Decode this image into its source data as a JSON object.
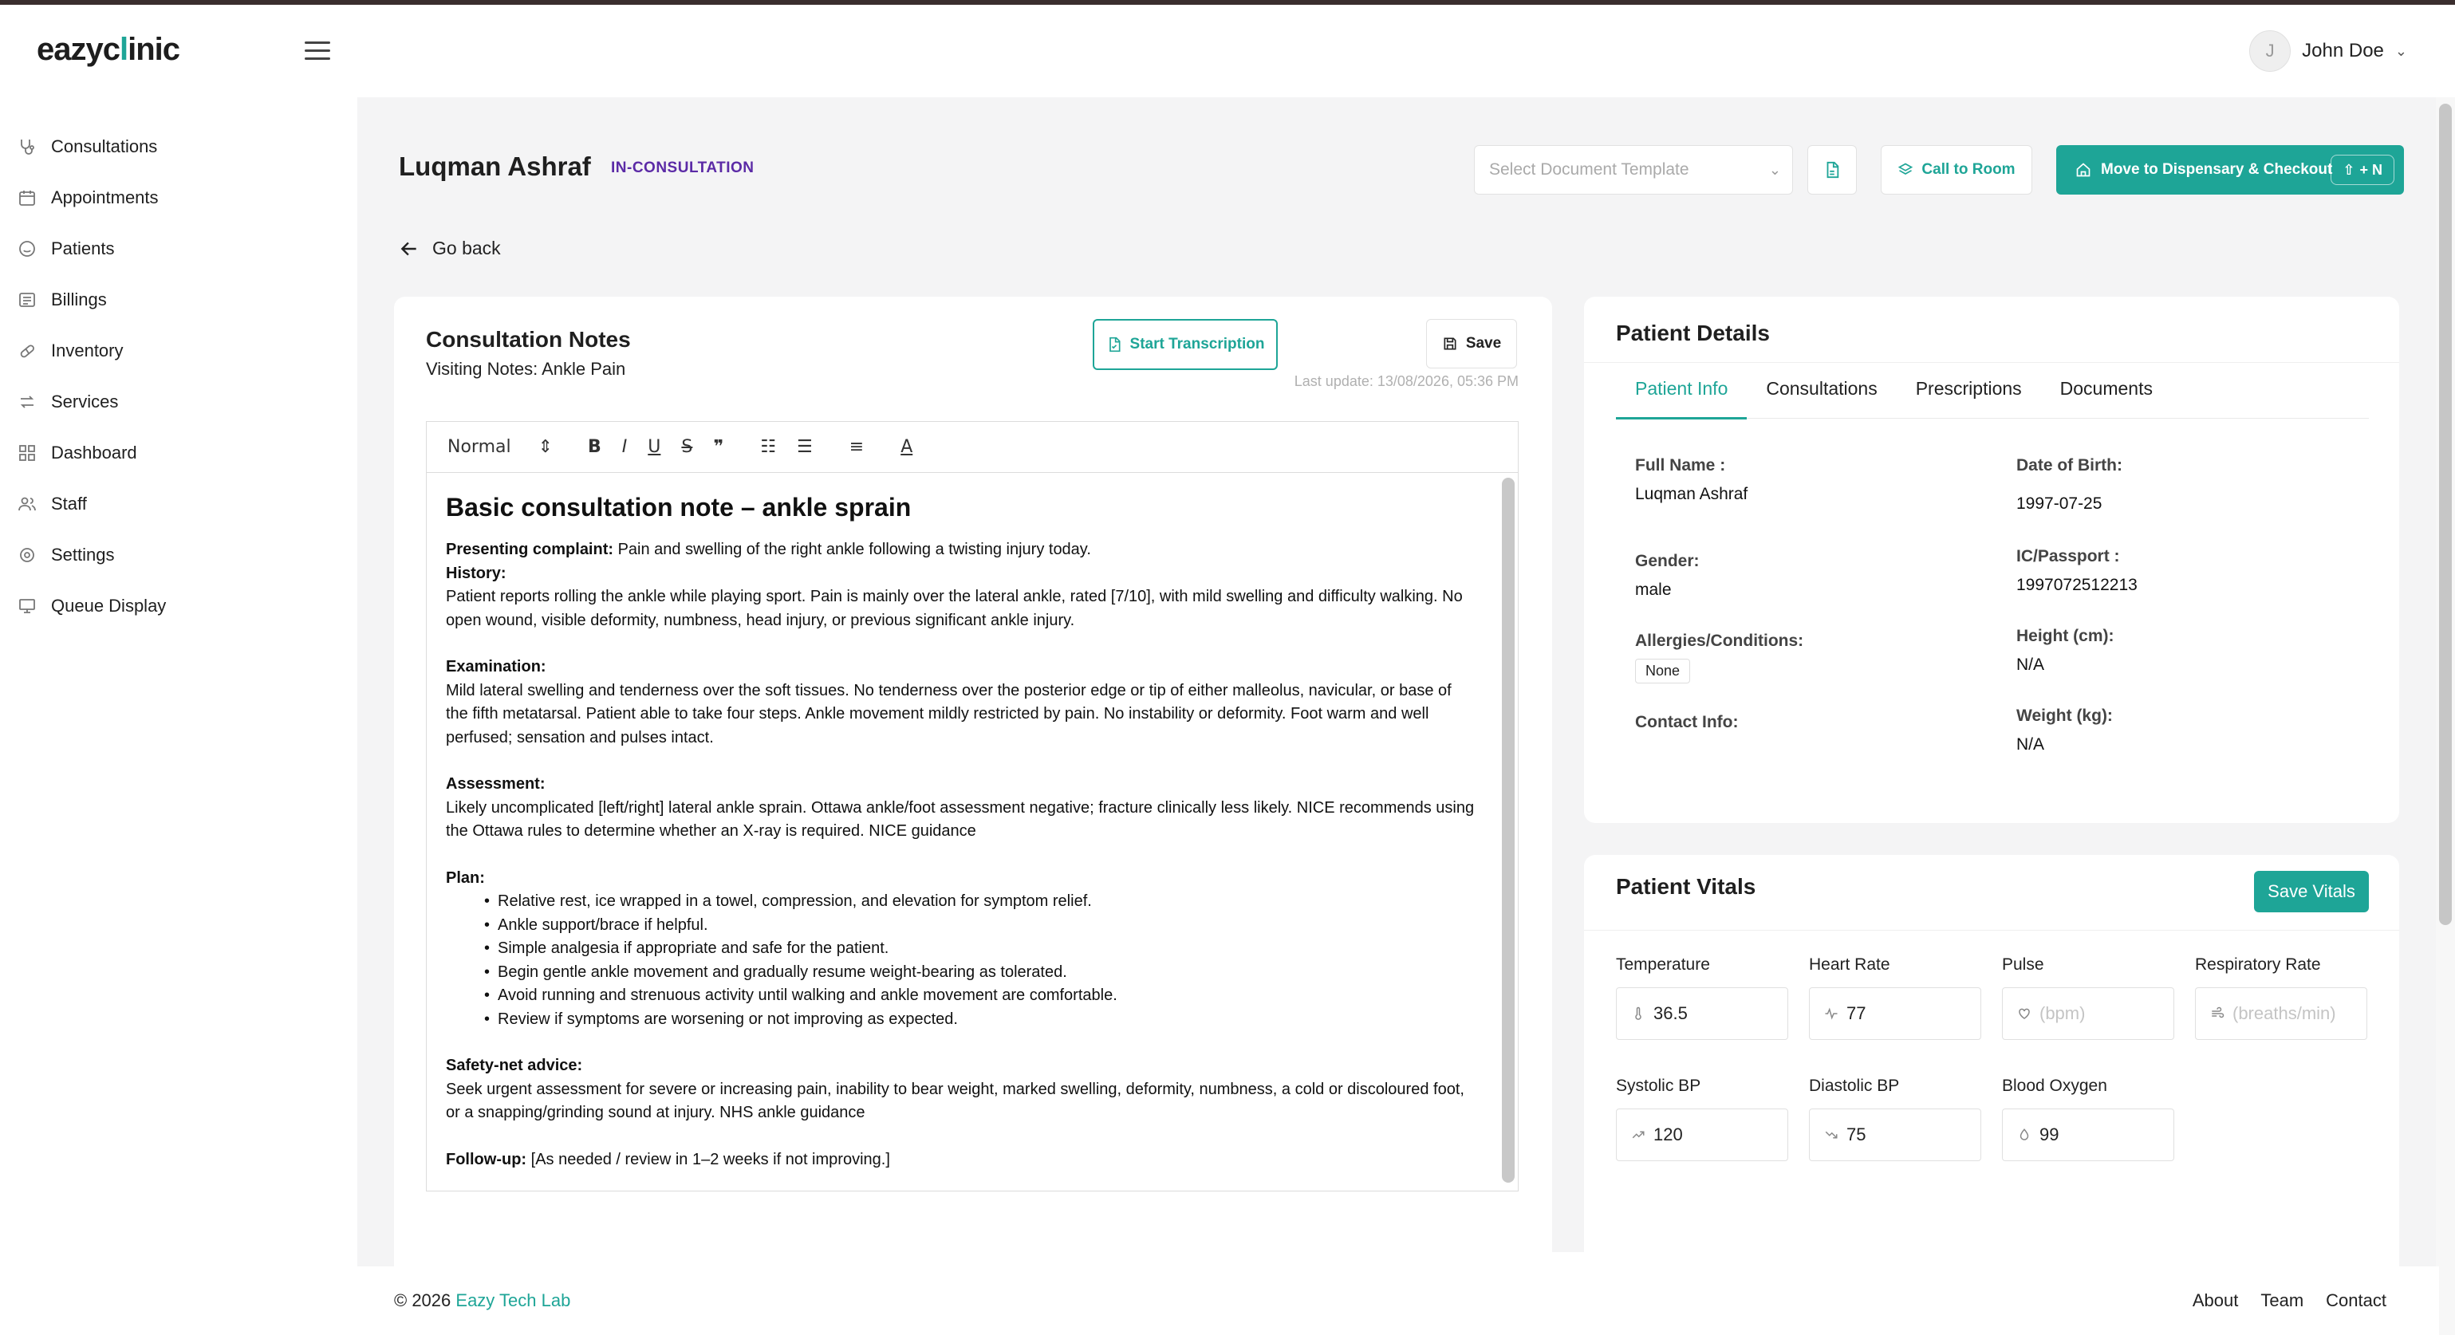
{
  "app": {
    "logo_prefix": "eazyc",
    "logo_mid": "l",
    "logo_suffix": "inic"
  },
  "user": {
    "initial": "J",
    "name": "John Doe"
  },
  "sidebar": {
    "items": [
      {
        "label": "Consultations",
        "icon": "stethoscope-icon"
      },
      {
        "label": "Appointments",
        "icon": "calendar-icon"
      },
      {
        "label": "Patients",
        "icon": "smiley-icon"
      },
      {
        "label": "Billings",
        "icon": "billing-icon"
      },
      {
        "label": "Inventory",
        "icon": "pill-icon"
      },
      {
        "label": "Services",
        "icon": "arrows-icon"
      },
      {
        "label": "Dashboard",
        "icon": "dashboard-icon"
      },
      {
        "label": "Staff",
        "icon": "users-icon"
      },
      {
        "label": "Settings",
        "icon": "gear-icon"
      },
      {
        "label": "Queue Display",
        "icon": "monitor-icon"
      }
    ]
  },
  "page": {
    "patient_name": "Luqman Ashraf",
    "status": "IN-CONSULTATION",
    "template_placeholder": "Select Document Template",
    "call_room_label": "Call to Room",
    "checkout_label": "Move to Dispensary & Checkout",
    "checkout_shortcut": "+ N",
    "go_back_label": "Go back"
  },
  "notes": {
    "title": "Consultation Notes",
    "subtitle": "Visiting Notes: Ankle Pain",
    "transcribe_label": "Start Transcription",
    "save_label": "Save",
    "last_update": "Last update: 13/08/2026, 05:36 PM",
    "format_value": "Normal",
    "heading": "Basic consultation note – ankle sprain",
    "presenting_label": "Presenting complaint:",
    "presenting_text": " Pain and swelling of the right ankle following a twisting injury today.",
    "history_label": "History:",
    "history_text": "Patient reports rolling the ankle while playing sport. Pain is mainly over the lateral ankle, rated [7/10], with mild swelling and difficulty walking. No open wound, visible deformity, numbness, head injury, or previous significant ankle injury.",
    "exam_label": "Examination:",
    "exam_text": "Mild lateral swelling and tenderness over the soft tissues. No tenderness over the posterior edge or tip of either malleolus, navicular, or base of the fifth metatarsal. Patient able to take four steps. Ankle movement mildly restricted by pain. No instability or deformity. Foot warm and well perfused; sensation and pulses intact.",
    "assessment_label": "Assessment:",
    "assessment_text": "Likely uncomplicated [left/right] lateral ankle sprain. Ottawa ankle/foot assessment negative; fracture clinically less likely. NICE recommends using the Ottawa rules to determine whether an X-ray is required. NICE guidance",
    "plan_label": "Plan:",
    "plan_items": [
      "Relative rest, ice wrapped in a towel, compression, and elevation for symptom relief.",
      "Ankle support/brace if helpful.",
      "Simple analgesia if appropriate and safe for the patient.",
      "Begin gentle ankle movement and gradually resume weight-bearing as tolerated.",
      "Avoid running and strenuous activity until walking and ankle movement are comfortable.",
      "Review if symptoms are worsening or not improving as expected."
    ],
    "safety_label": "Safety-net advice:",
    "safety_text": "Seek urgent assessment for severe or increasing pain, inability to bear weight, marked swelling, deformity, numbness, a cold or discoloured foot, or a snapping/grinding sound at injury. NHS ankle guidance",
    "followup_label": "Follow-up:",
    "followup_text": " [As needed / review in 1–2 weeks if not improving.]"
  },
  "details": {
    "title": "Patient Details",
    "tabs": [
      "Patient Info",
      "Consultations",
      "Prescriptions",
      "Documents"
    ],
    "full_name_label": "Full Name :",
    "full_name": "Luqman Ashraf",
    "dob_label": "Date of Birth:",
    "dob": "1997-07-25",
    "gender_label": "Gender:",
    "gender": "male",
    "ic_label": "IC/Passport :",
    "ic": "1997072512213",
    "allergies_label": "Allergies/Conditions:",
    "allergies": "None",
    "height_label": "Height (cm):",
    "height": "N/A",
    "contact_label": "Contact Info:",
    "weight_label": "Weight (kg):",
    "weight": "N/A"
  },
  "vitals": {
    "title": "Patient Vitals",
    "save_label": "Save Vitals",
    "temperature_label": "Temperature",
    "temperature": "36.5",
    "heart_rate_label": "Heart Rate",
    "heart_rate": "77",
    "pulse_label": "Pulse",
    "pulse_placeholder": "(bpm)",
    "resp_label": "Respiratory Rate",
    "resp_placeholder": "(breaths/min)",
    "systolic_label": "Systolic BP",
    "systolic": "120",
    "diastolic_label": "Diastolic BP",
    "diastolic": "75",
    "oxygen_label": "Blood Oxygen",
    "oxygen": "99"
  },
  "footer": {
    "copyright": "© 2026 ",
    "brand": "Eazy Tech Lab",
    "links": [
      "About",
      "Team",
      "Contact"
    ]
  },
  "colors": {
    "accent": "#1ea597",
    "status": "#5b2aa6"
  }
}
